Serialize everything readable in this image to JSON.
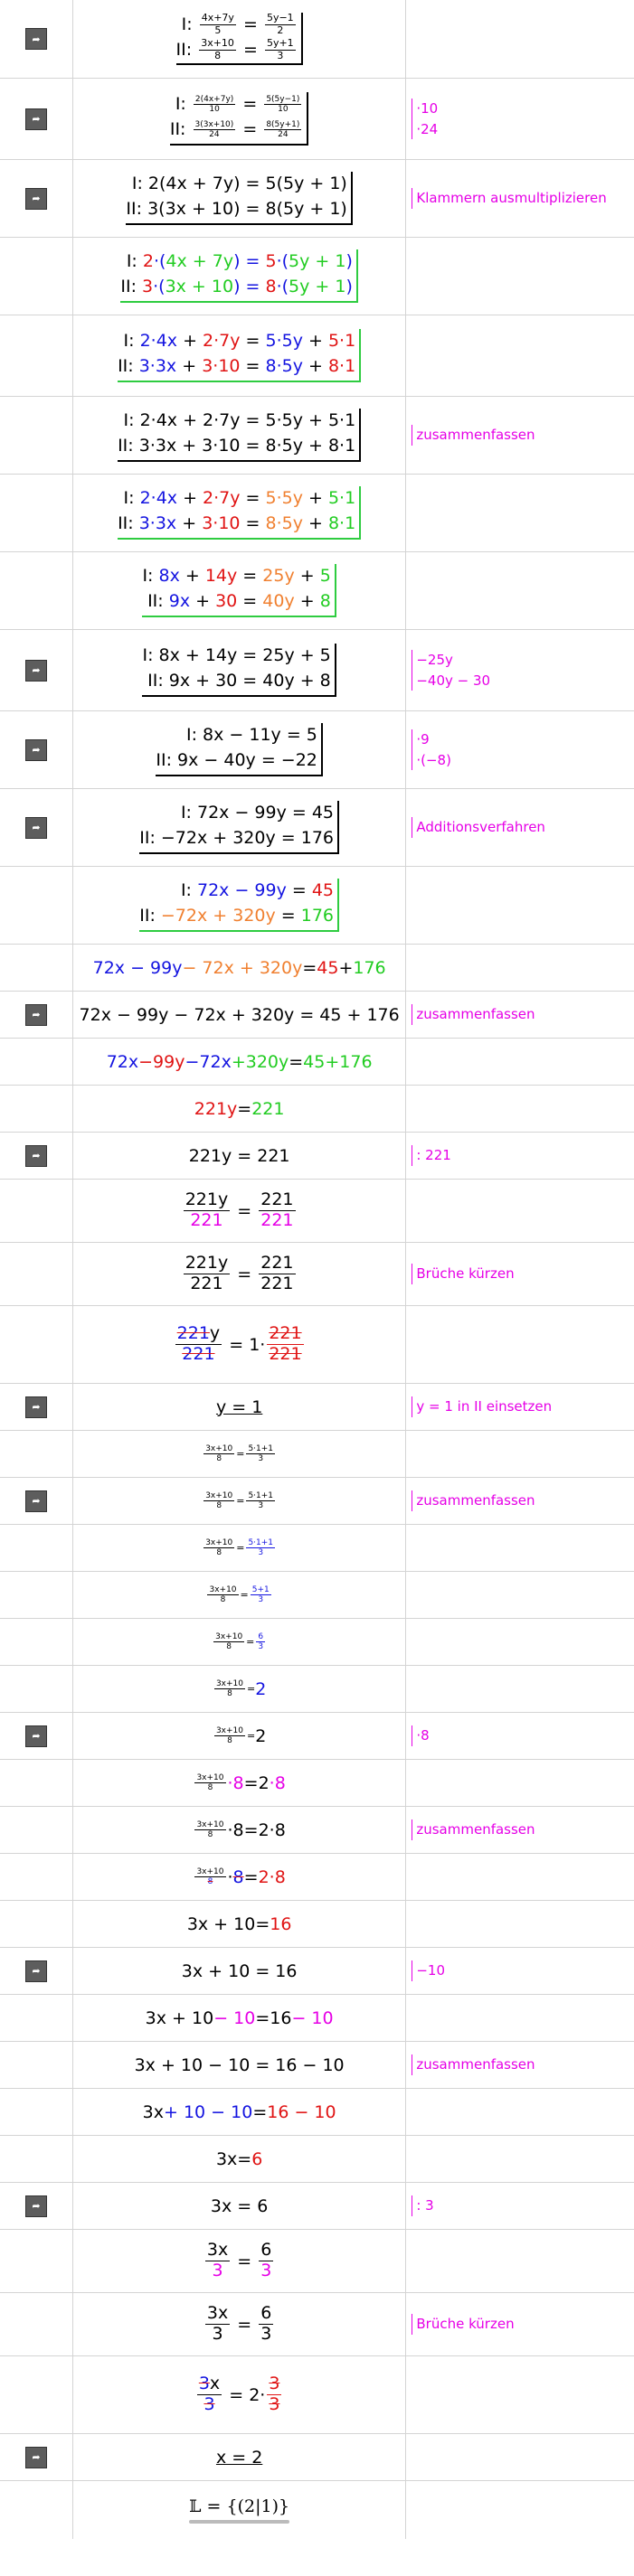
{
  "steps": {
    "s1": {
      "l1_lead": "I:",
      "l1_n1": "4x+7y",
      "l1_d1": "5",
      "l1_eq": "=",
      "l1_n2": "5y−1",
      "l1_d2": "2",
      "l2_lead": "II:",
      "l2_n1": "3x+10",
      "l2_d1": "8",
      "l2_eq": "=",
      "l2_n2": "5y+1",
      "l2_d2": "3"
    },
    "s2": {
      "l1_lead": "I:",
      "l1_n1": "2(4x+7y)",
      "l1_d1": "10",
      "l1_eq": "=",
      "l1_n2": "5(5y−1)",
      "l1_d2": "10",
      "l2_lead": "II:",
      "l2_n1": "3(3x+10)",
      "l2_d1": "24",
      "l2_eq": "=",
      "l2_n2": "8(5y+1)",
      "l2_d2": "24",
      "note1": "·10",
      "note2": "·24"
    },
    "s3": {
      "l1": "I: 2(4x + 7y) = 5(5y + 1)",
      "l2": "II: 3(3x + 10) = 8(5y + 1)",
      "note": "Klammern ausmultiplizieren"
    },
    "s4": {
      "l1_lead": "I: ",
      "l1_a": "2",
      "l1_b": "·(",
      "l1_c": "4x + 7y",
      "l1_d": ") = ",
      "l1_e": "5",
      "l1_f": "·(",
      "l1_g": "5y + 1",
      "l1_h": ")",
      "l2_lead": "II: ",
      "l2_a": "3",
      "l2_b": "·(",
      "l2_c": "3x + 10",
      "l2_d": ") = ",
      "l2_e": "8",
      "l2_f": "·(",
      "l2_g": "5y + 1",
      "l2_h": ")"
    },
    "s5": {
      "l1_lead": "I: ",
      "l1_p1": "2·4x",
      "l1_p2": " + ",
      "l1_p3": "2·7y",
      "l1_p4": " = ",
      "l1_p5": "5·5y",
      "l1_p6": " + ",
      "l1_p7": "5·1",
      "l2_lead": "II: ",
      "l2_p1": "3·3x",
      "l2_p2": " + ",
      "l2_p3": "3·10",
      "l2_p4": " = ",
      "l2_p5": "8·5y",
      "l2_p6": " + ",
      "l2_p7": "8·1"
    },
    "s6": {
      "l1": "I: 2·4x + 2·7y = 5·5y + 5·1",
      "l2": "II: 3·3x + 3·10 = 8·5y + 8·1",
      "note": "zusammenfassen"
    },
    "s7": {
      "l1_lead": "I: ",
      "l1_p1": "2·4x",
      "l1_p2": " + ",
      "l1_p3": "2·7y",
      "l1_p4": " = ",
      "l1_p5": "5·5y",
      "l1_p6": " + ",
      "l1_p7": "5·1",
      "l2_lead": "II: ",
      "l2_p1": "3·3x",
      "l2_p2": " + ",
      "l2_p3": "3·10",
      "l2_p4": " = ",
      "l2_p5": "8·5y",
      "l2_p6": " + ",
      "l2_p7": "8·1"
    },
    "s8": {
      "l1_lead": "I: ",
      "l1_p1": "8x",
      "l1_p2": " + ",
      "l1_p3": "14y",
      "l1_p4": " = ",
      "l1_p5": "25y",
      "l1_p6": " + ",
      "l1_p7": "5",
      "l2_lead": "II: ",
      "l2_p1": "9x",
      "l2_p2": " + ",
      "l2_p3": "30",
      "l2_p4": " = ",
      "l2_p5": "40y",
      "l2_p6": " + ",
      "l2_p7": "8"
    },
    "s9": {
      "l1": "I: 8x + 14y = 25y + 5",
      "l2": "II: 9x + 30 = 40y + 8",
      "note1": "−25y",
      "note2": "−40y − 30"
    },
    "s10": {
      "l1": "I: 8x − 11y = 5",
      "l2": "II: 9x − 40y = −22",
      "note1": "·9",
      "note2": "·(−8)"
    },
    "s11": {
      "l1": "I: 72x − 99y = 45",
      "l2": "II: −72x + 320y = 176",
      "note": "Additionsverfahren"
    },
    "s12": {
      "l1_lead": "I: ",
      "l1_p1": "72x − 99y",
      "l1_p2": " = ",
      "l1_p3": "45",
      "l2_lead": "II: ",
      "l2_p1": "−72x + 320y",
      "l2_p2": " = ",
      "l2_p3": "176"
    },
    "s13": {
      "p1": "72x − 99y",
      "p2": " − 72x + 320y",
      "p3": " = ",
      "p4": "45",
      "p5": " + ",
      "p6": "176"
    },
    "s14": {
      "text": "72x − 99y − 72x + 320y = 45 + 176",
      "note": "zusammenfassen"
    },
    "s15": {
      "p1": "72x",
      "p2": " − ",
      "p3": "99y",
      "p4": " − ",
      "p5": "72x",
      "p6": " + ",
      "p7": "320y",
      "p8": " = ",
      "p9": "45",
      "p10": " + ",
      "p11": "176"
    },
    "s16": {
      "p1": "221y",
      "p2": " = ",
      "p3": "221"
    },
    "s17": {
      "text": "221y = 221",
      "note": ": 221"
    },
    "s18": {
      "n1": "221y",
      "d1": "221",
      "eq": "=",
      "n2": "221",
      "d2": "221"
    },
    "s19": {
      "n1": "221y",
      "d1": "221",
      "eq": "=",
      "n2": "221",
      "d2": "221",
      "note": "Brüche kürzen"
    },
    "s20": {
      "n1a": "221",
      "n1b": "y",
      "d1": "221",
      "eq": "=",
      "pre": "1·",
      "n2": "221",
      "d2": "221"
    },
    "s21": {
      "text": "y = 1",
      "note": "y = 1 in II einsetzen"
    },
    "s22": {
      "n1": "3x+10",
      "d1": "8",
      "eq": "=",
      "n2": "5·1+1",
      "d2": "3"
    },
    "s23": {
      "n1": "3x+10",
      "d1": "8",
      "eq": "=",
      "n2": "5·1+1",
      "d2": "3",
      "note": "zusammenfassen"
    },
    "s24": {
      "n1": "3x+10",
      "d1": "8",
      "eq": "=",
      "n2": "5·1+1",
      "d2": "3"
    },
    "s25": {
      "n1": "3x+10",
      "d1": "8",
      "eq": "=",
      "n2": "5+1",
      "d2": "3"
    },
    "s26": {
      "n1": "3x+10",
      "d1": "8",
      "eq": "=",
      "n2": "6",
      "d2": "3"
    },
    "s27": {
      "n1": "3x+10",
      "d1": "8",
      "eq": "=",
      "rhs": "2"
    },
    "s28": {
      "n1": "3x+10",
      "d1": "8",
      "eq": "=",
      "rhs": "2",
      "note": "·8"
    },
    "s29": {
      "n1": "3x+10",
      "d1": "8",
      "mul": "·8",
      "eq": " = ",
      "rhs": "2",
      "rhs2": "·8"
    },
    "s30": {
      "n1": "3x+10",
      "d1": "8",
      "mul": "·8",
      "eq": " = ",
      "rhs": "2·8",
      "note": "zusammenfassen"
    },
    "s31": {
      "n1": "3x+10",
      "d1": "8",
      "mul": "·",
      "mul2": "8",
      "eq": " = ",
      "rhs": "2·8"
    },
    "s32": {
      "p1": "3x + 10",
      "p2": " = ",
      "p3": "16"
    },
    "s33": {
      "text": "3x + 10 = 16",
      "note": "−10"
    },
    "s34": {
      "p1": "3x + 10",
      "p2": " − 10",
      "p3": " = ",
      "p4": "16",
      "p5": " − 10"
    },
    "s35": {
      "text": "3x + 10 − 10 = 16 − 10",
      "note": "zusammenfassen"
    },
    "s36": {
      "p1": "3x",
      "p2": " + 10 − 10",
      "p3": " = ",
      "p4": "16 − 10"
    },
    "s37": {
      "p1": "3x",
      "p2": " = ",
      "p3": "6"
    },
    "s38": {
      "text": "3x = 6",
      "note": ": 3"
    },
    "s39": {
      "n1": "3x",
      "d1": "3",
      "eq": "=",
      "n2": "6",
      "d2": "3"
    },
    "s40": {
      "n1": "3x",
      "d1": "3",
      "eq": "=",
      "n2": "6",
      "d2": "3",
      "note": "Brüche kürzen"
    },
    "s41": {
      "n1a": "3",
      "n1b": "x",
      "d1": "3",
      "eq": "=",
      "pre": "2·",
      "n2": "3",
      "d2": "3"
    },
    "s42": {
      "text": "x = 2"
    },
    "s43": {
      "text": "𝕃 = {(2|1)}"
    }
  }
}
